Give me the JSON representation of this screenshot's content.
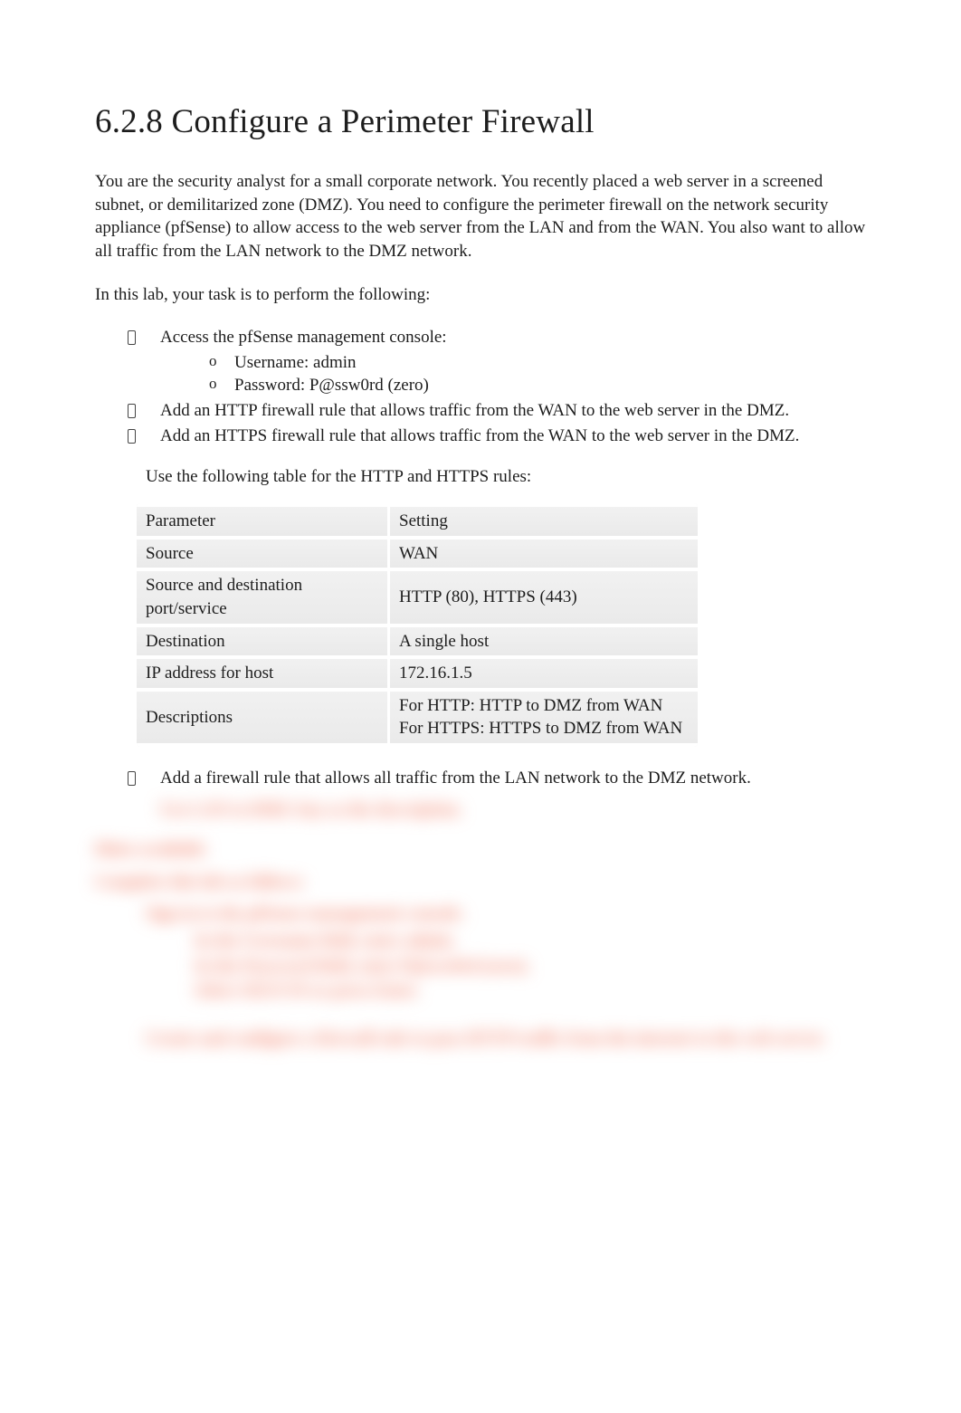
{
  "title": "6.2.8 Configure a Perimeter Firewall",
  "intro1": "You are the security analyst for a small corporate network. You recently placed a web server in a screened subnet, or demilitarized zone (DMZ). You need to configure the perimeter firewall on the network security appliance (pfSense) to allow access to the web server from the LAN and from the WAN. You also want to allow all traffic from the LAN network to the DMZ network.",
  "intro2": "In this lab, your task is to perform the following:",
  "task_access": "Access the pfSense management console:",
  "username_line": "Username: admin",
  "password_line": "Password: P@ssw0rd  (zero)",
  "task_http": "Add an HTTP firewall rule that allows traffic from the WAN to the web server in the DMZ.",
  "task_https": "Add an HTTPS firewall rule that allows traffic from the WAN to the web server in the DMZ.",
  "table_intro": "Use the following table for the HTTP and HTTPS rules:",
  "table": {
    "rows": [
      {
        "param": "Parameter",
        "setting": "Setting"
      },
      {
        "param": "Source",
        "setting": "WAN"
      },
      {
        "param": "Source and destination port/service",
        "setting": "HTTP (80), HTTPS (443)"
      },
      {
        "param": "Destination",
        "setting": "A single host"
      },
      {
        "param": "IP address for host",
        "setting": "172.16.1.5"
      },
      {
        "param": "Descriptions",
        "setting": "For HTTP: HTTP to DMZ from WAN\nFor HTTPS: HTTPS to DMZ from WAN"
      }
    ]
  },
  "task_lan": "Add a firewall rule that allows all traffic from the LAN network to the DMZ network.",
  "blur": {
    "desc_line": "Use LAN to DMZ Any  as the description.",
    "hints": "Hints available",
    "complete": "Complete this lab as follows:",
    "step1": "Sign in to the pfSense management console.",
    "s1a": "In the Username field, enter admin.",
    "s1b": "In the Password field, enter P@ssw0rd (zero).",
    "s1c": "Select SIGN IN or press Enter.",
    "step2": "Create and configure a firewall rule to pass HTTP traffic from the internet to the web server."
  }
}
